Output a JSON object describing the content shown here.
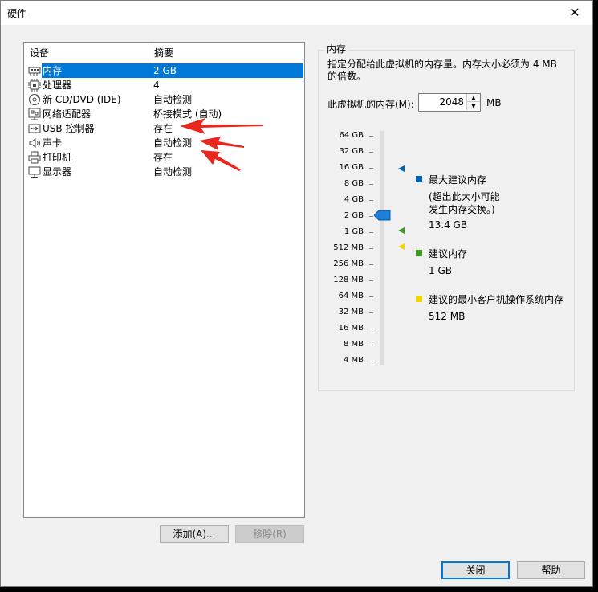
{
  "window": {
    "title": "硬件",
    "close_glyph": "✕"
  },
  "device_list": {
    "headers": [
      "设备",
      "摘要"
    ],
    "rows": [
      {
        "name": "内存",
        "summary": "2 GB",
        "icon": "memory-icon",
        "selected": true
      },
      {
        "name": "处理器",
        "summary": "4",
        "icon": "cpu-icon"
      },
      {
        "name": "新 CD/DVD (IDE)",
        "summary": "自动检测",
        "icon": "cd-dvd-icon"
      },
      {
        "name": "网络适配器",
        "summary": "桥接模式 (自动)",
        "icon": "network-icon"
      },
      {
        "name": "USB 控制器",
        "summary": "存在",
        "icon": "usb-icon"
      },
      {
        "name": "声卡",
        "summary": "自动检测",
        "icon": "sound-icon"
      },
      {
        "name": "打印机",
        "summary": "存在",
        "icon": "printer-icon"
      },
      {
        "name": "显示器",
        "summary": "自动检测",
        "icon": "display-icon"
      }
    ]
  },
  "buttons": {
    "add": "添加(A)...",
    "remove": "移除(R)",
    "close": "关闭",
    "help": "帮助"
  },
  "memory_panel": {
    "title": "内存",
    "description": "指定分配给此虚拟机的内存量。内存大小必须为 4 MB 的倍数。",
    "field_label": "此虚拟机的内存(M):",
    "value": "2048",
    "unit": "MB",
    "scale": [
      "64 GB",
      "32 GB",
      "16 GB",
      "8 GB",
      "4 GB",
      "2 GB",
      "1 GB",
      "512 MB",
      "256 MB",
      "128 MB",
      "64 MB",
      "32 MB",
      "16 MB",
      "8 MB",
      "4 MB"
    ],
    "current_level": "2 GB",
    "legend": [
      {
        "title": "最大建议内存",
        "note": "(超出此大小可能\n发生内存交换。)",
        "value": "13.4 GB",
        "color": "#0063b1"
      },
      {
        "title": "建议内存",
        "value": "1 GB",
        "color": "#3c9a1e"
      },
      {
        "title": "建议的最小客户机操作系统内存",
        "value": "512 MB",
        "color": "#f2d600"
      }
    ]
  },
  "colors": {
    "selection": "#0078d7",
    "annotation_arrow": "#e8261c"
  }
}
